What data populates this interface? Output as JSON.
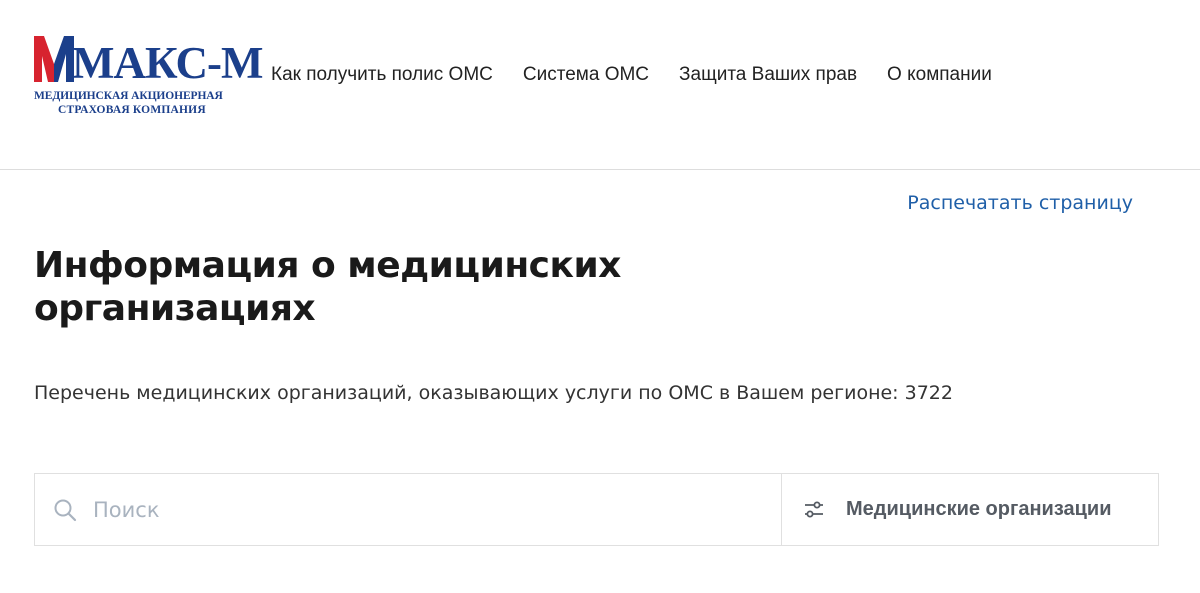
{
  "header": {
    "logo": {
      "title": "МАКС-М",
      "subtitle_line1": "МЕДИЦИНСКАЯ АКЦИОНЕРНАЯ",
      "subtitle_line2": "СТРАХОВАЯ КОМПАНИЯ"
    },
    "nav": [
      {
        "label": "Как получить полис ОМС"
      },
      {
        "label": "Система ОМС"
      },
      {
        "label": "Защита Ваших прав"
      },
      {
        "label": "О компании"
      }
    ]
  },
  "main": {
    "print_link": "Распечатать страницу",
    "title": "Информация о медицинских организациях",
    "summary": "Перечень медицинских организаций, оказывающих услуги по ОМС в Вашем регионе: 3722",
    "search": {
      "placeholder": "Поиск",
      "value": "",
      "icon": "search-icon"
    },
    "filter": {
      "label": "Медицинские организации",
      "icon": "sliders-icon"
    }
  },
  "colors": {
    "brand_blue": "#1b3f8b",
    "brand_red": "#d7232f",
    "link_blue": "#1f5fa8"
  }
}
